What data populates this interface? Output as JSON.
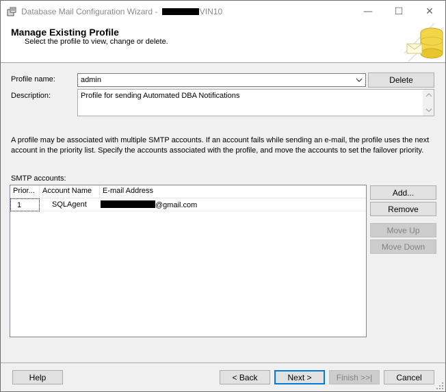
{
  "window": {
    "title_prefix": "Database Mail Configuration Wizard - ",
    "title_suffix": "VIN10",
    "minimize": "—",
    "maximize": "☐",
    "close": "✕"
  },
  "header": {
    "title": "Manage Existing Profile",
    "subtitle": "Select the profile to view, change or delete."
  },
  "profile": {
    "name_label": "Profile name:",
    "name_value": "admin",
    "delete_label": "Delete",
    "description_label": "Description:",
    "description_value": "Profile for sending Automated DBA Notifications"
  },
  "info_text": "A profile may be associated with multiple SMTP accounts. If an account fails while sending an e-mail, the profile uses the next account in the priority list. Specify the accounts associated with the profile, and move the accounts to set the failover priority.",
  "smtp": {
    "label": "SMTP accounts:",
    "columns": [
      "Prior...",
      "Account Name",
      "E-mail Address"
    ],
    "rows": [
      {
        "priority": "1",
        "account_name": "SQLAgent",
        "email_suffix": "@gmail.com"
      }
    ],
    "buttons": {
      "add": "Add...",
      "remove": "Remove",
      "move_up": "Move Up",
      "move_down": "Move Down"
    }
  },
  "footer": {
    "help": "Help",
    "back": "< Back",
    "next": "Next >",
    "finish": "Finish >>|",
    "cancel": "Cancel"
  },
  "colors": {
    "accent": "#0078d7",
    "window_bg": "#f0f0f0",
    "disabled_text": "#838383"
  }
}
